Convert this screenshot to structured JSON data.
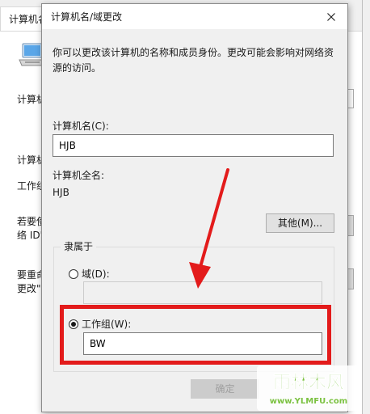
{
  "background_window": {
    "tab_label": "计算机名",
    "lines": [
      "计算机",
      "计算机",
      "工作组",
      "若要使",
      "络 ID\"",
      "要重命",
      "更改\"。"
    ]
  },
  "dialog": {
    "title": "计算机名/域更改",
    "description": "你可以更改该计算机的名称和成员身份。更改可能会影响对网络资源的访问。",
    "computer_name_label": "计算机名(C):",
    "computer_name_value": "HJB",
    "full_name_label": "计算机全名:",
    "full_name_value": "HJB",
    "other_button": "其他(M)...",
    "member_of_legend": "隶属于",
    "domain_radio_label": "域(D):",
    "domain_value": "",
    "workgroup_radio_label": "工作组(W):",
    "workgroup_value": "BW",
    "ok_button": "确定",
    "selected_membership": "workgroup"
  },
  "watermark": {
    "name": "雨林木风",
    "url": "www.YLMFU.com"
  },
  "colors": {
    "annotation_red": "#e31b1b",
    "dialog_bg": "#f0f0f0",
    "watermark_green": "#7cc242"
  }
}
